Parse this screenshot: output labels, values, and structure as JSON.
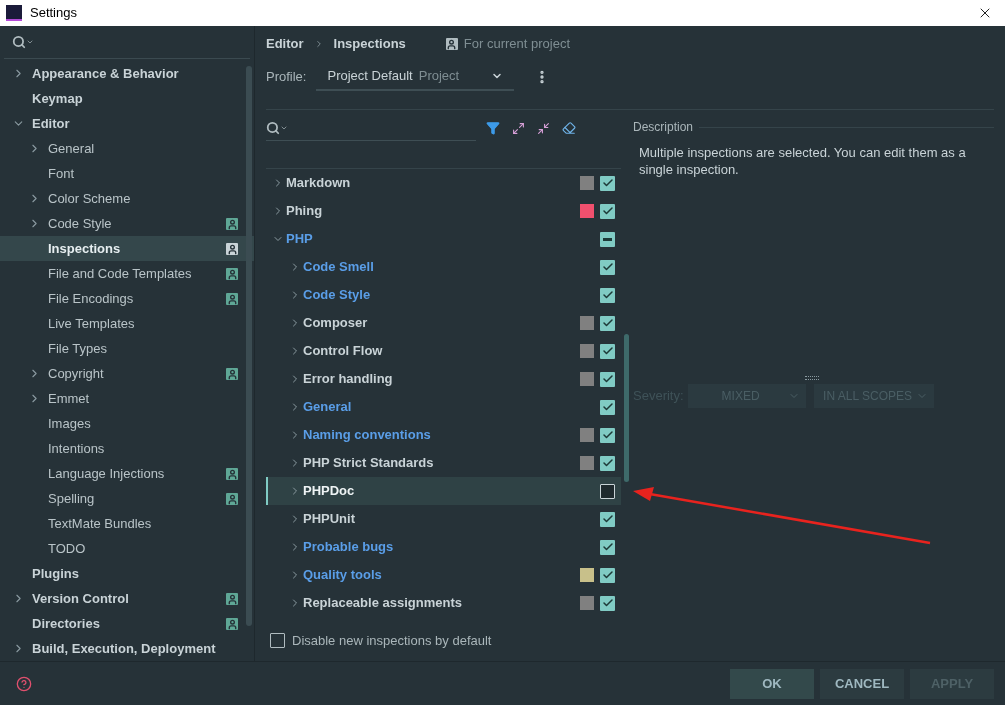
{
  "window": {
    "title": "Settings"
  },
  "sidebar": {
    "items": [
      {
        "label": "Appearance & Behavior",
        "kind": "folder",
        "expanded": false,
        "selected": false,
        "shared": false
      },
      {
        "label": "Keymap",
        "kind": "leaf",
        "selected": false,
        "shared": false
      },
      {
        "label": "Editor",
        "kind": "folder",
        "expanded": true,
        "selected": false,
        "shared": false,
        "children": [
          {
            "label": "General",
            "kind": "folder",
            "expanded": false,
            "selected": false,
            "shared": false
          },
          {
            "label": "Font",
            "kind": "leaf",
            "selected": false,
            "shared": false
          },
          {
            "label": "Color Scheme",
            "kind": "folder",
            "expanded": false,
            "selected": false,
            "shared": false
          },
          {
            "label": "Code Style",
            "kind": "folder",
            "expanded": false,
            "selected": false,
            "shared": true
          },
          {
            "label": "Inspections",
            "kind": "leaf",
            "selected": true,
            "shared": true
          },
          {
            "label": "File and Code Templates",
            "kind": "leaf",
            "selected": false,
            "shared": true
          },
          {
            "label": "File Encodings",
            "kind": "leaf",
            "selected": false,
            "shared": true
          },
          {
            "label": "Live Templates",
            "kind": "leaf",
            "selected": false,
            "shared": false
          },
          {
            "label": "File Types",
            "kind": "leaf",
            "selected": false,
            "shared": false
          },
          {
            "label": "Copyright",
            "kind": "folder",
            "expanded": false,
            "selected": false,
            "shared": true
          },
          {
            "label": "Emmet",
            "kind": "folder",
            "expanded": false,
            "selected": false,
            "shared": false
          },
          {
            "label": "Images",
            "kind": "leaf",
            "selected": false,
            "shared": false
          },
          {
            "label": "Intentions",
            "kind": "leaf",
            "selected": false,
            "shared": false
          },
          {
            "label": "Language Injections",
            "kind": "leaf",
            "selected": false,
            "shared": true
          },
          {
            "label": "Spelling",
            "kind": "leaf",
            "selected": false,
            "shared": true
          },
          {
            "label": "TextMate Bundles",
            "kind": "leaf",
            "selected": false,
            "shared": false
          },
          {
            "label": "TODO",
            "kind": "leaf",
            "selected": false,
            "shared": false
          }
        ]
      },
      {
        "label": "Plugins",
        "kind": "leaf",
        "selected": false,
        "shared": false
      },
      {
        "label": "Version Control",
        "kind": "folder",
        "expanded": false,
        "selected": false,
        "shared": true
      },
      {
        "label": "Directories",
        "kind": "leaf",
        "selected": false,
        "shared": true
      },
      {
        "label": "Build, Execution, Deployment",
        "kind": "folder",
        "expanded": false,
        "selected": false,
        "shared": false
      }
    ]
  },
  "header": {
    "breadcrumb": [
      "Editor",
      "Inspections"
    ],
    "scope_note": "For current project"
  },
  "profile": {
    "label": "Profile:",
    "value": "Project Default",
    "hint": "Project"
  },
  "tree": {
    "rows": [
      {
        "label": "Markdown",
        "expanded": false,
        "modified": false,
        "selected": false,
        "color": "#808080",
        "checked": true
      },
      {
        "label": "Phing",
        "expanded": false,
        "modified": false,
        "selected": false,
        "color": "#f0506e",
        "checked": true
      },
      {
        "label": "PHP",
        "expanded": true,
        "modified": true,
        "selected": false,
        "checked": true,
        "mixed": true,
        "children": [
          {
            "label": "Code Smell",
            "expanded": false,
            "modified": true,
            "selected": false,
            "checked": true
          },
          {
            "label": "Code Style",
            "expanded": false,
            "modified": true,
            "selected": false,
            "checked": true
          },
          {
            "label": "Composer",
            "expanded": false,
            "modified": false,
            "selected": false,
            "color": "#808080",
            "checked": true
          },
          {
            "label": "Control Flow",
            "expanded": false,
            "modified": false,
            "selected": false,
            "color": "#808080",
            "checked": true
          },
          {
            "label": "Error handling",
            "expanded": false,
            "modified": false,
            "selected": false,
            "color": "#808080",
            "checked": true
          },
          {
            "label": "General",
            "expanded": false,
            "modified": true,
            "selected": false,
            "checked": true
          },
          {
            "label": "Naming conventions",
            "expanded": false,
            "modified": true,
            "selected": false,
            "color": "#808080",
            "checked": true
          },
          {
            "label": "PHP Strict Standards",
            "expanded": false,
            "modified": false,
            "selected": false,
            "color": "#808080",
            "checked": true
          },
          {
            "label": "PHPDoc",
            "expanded": false,
            "modified": false,
            "selected": true,
            "checked": false
          },
          {
            "label": "PHPUnit",
            "expanded": false,
            "modified": false,
            "selected": false,
            "checked": true
          },
          {
            "label": "Probable bugs",
            "expanded": false,
            "modified": true,
            "selected": false,
            "checked": true
          },
          {
            "label": "Quality tools",
            "expanded": false,
            "modified": true,
            "selected": false,
            "color": "#c8c08a",
            "checked": true
          },
          {
            "label": "Replaceable assignments",
            "expanded": false,
            "modified": false,
            "selected": false,
            "color": "#808080",
            "checked": true
          }
        ]
      }
    ]
  },
  "description": {
    "title": "Description",
    "text": "Multiple inspections are selected. You can edit them as a single inspection."
  },
  "severity": {
    "label": "Severity:",
    "value": "MIXED",
    "scope": "IN ALL SCOPES",
    "disabled": true
  },
  "disable_new": {
    "label": "Disable new inspections by default",
    "checked": false
  },
  "buttons": [
    {
      "label": "OK",
      "kind": "default",
      "disabled": false
    },
    {
      "label": "CANCEL",
      "kind": "normal",
      "disabled": false
    },
    {
      "label": "APPLY",
      "kind": "normal",
      "disabled": true
    }
  ]
}
